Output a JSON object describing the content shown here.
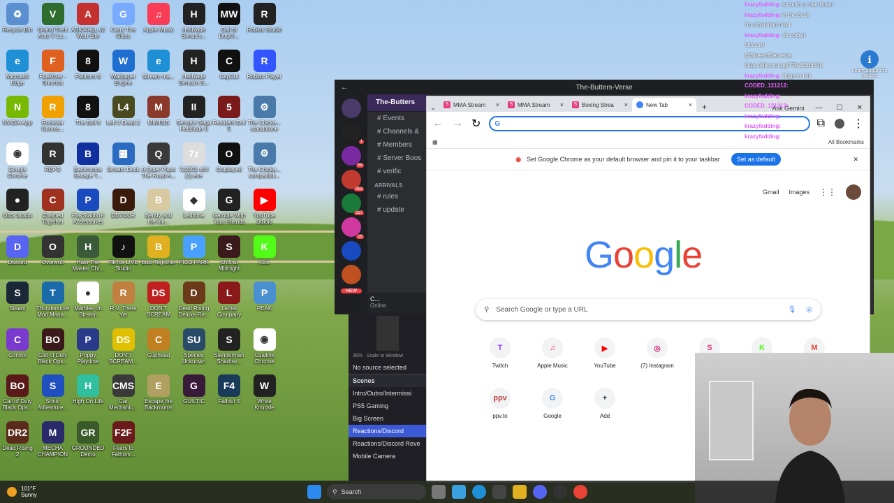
{
  "desktop": {
    "icons": [
      {
        "label": "Recycle Bin",
        "color": "#5a8fd0",
        "glyph": "♻"
      },
      {
        "label": "Grand Theft Auto V La...",
        "color": "#2e6d2e",
        "glyph": "V"
      },
      {
        "label": "ASIO4ALL v2 Web Site",
        "color": "#c43030",
        "glyph": "A"
      },
      {
        "label": "Carry The Glass",
        "color": "#78aaff",
        "glyph": "G"
      },
      {
        "label": "Apple Music",
        "color": "#fa3d56",
        "glyph": "♫"
      },
      {
        "label": "Hellblade Senua's...",
        "color": "#222",
        "glyph": "H"
      },
      {
        "label": "Call of Duty®...",
        "color": "#111",
        "glyph": "MW"
      },
      {
        "label": "Roblox Studio",
        "color": "#222",
        "glyph": "R"
      },
      {
        "label": "Microsoft Edge",
        "color": "#1f8fd6",
        "glyph": "e"
      },
      {
        "label": "FireMixer - Shortcut",
        "color": "#e06020",
        "glyph": "F"
      },
      {
        "label": "Platform 8",
        "color": "#111",
        "glyph": "8"
      },
      {
        "label": "Wallpaper Engine",
        "color": "#1e6fd0",
        "glyph": "W"
      },
      {
        "label": "Stream ma...",
        "color": "#1f8fd6",
        "glyph": "e"
      },
      {
        "label": "Hellblade Senua's S...",
        "color": "#222",
        "glyph": "H"
      },
      {
        "label": "CapCut",
        "color": "#111",
        "glyph": "C"
      },
      {
        "label": "Roblox Player",
        "color": "#3355ff",
        "glyph": "R"
      },
      {
        "label": "NVIDIA App",
        "color": "#76b900",
        "glyph": "N"
      },
      {
        "label": "Rockstar Games...",
        "color": "#f0a000",
        "glyph": "R"
      },
      {
        "label": "The Exit 8",
        "color": "#111",
        "glyph": "8"
      },
      {
        "label": "Left 4 Dead 2",
        "color": "#4a4a20",
        "glyph": "L4"
      },
      {
        "label": "MIMISIS",
        "color": "#8a3a2a",
        "glyph": "M"
      },
      {
        "label": "Senua's Saga Hellblade II",
        "color": "#222",
        "glyph": "II"
      },
      {
        "label": "Resident Evil 5",
        "color": "#7a1a1a",
        "glyph": "5"
      },
      {
        "label": "The Chicke... standalone",
        "color": "#4a7aaa",
        "glyph": "⚙"
      },
      {
        "label": "Google Chrome",
        "color": "#fff",
        "glyph": "◉"
      },
      {
        "label": "REPO",
        "color": "#333",
        "glyph": "R"
      },
      {
        "label": "Backrooms Escape T...",
        "color": "#1030a0",
        "glyph": "B"
      },
      {
        "label": "Stream Deck",
        "color": "#2a6ac0",
        "glyph": "▦"
      },
      {
        "label": "A Quiet Place The Road A...",
        "color": "#3a3a3a",
        "glyph": "Q"
      },
      {
        "label": "7z2501-x64 (1).exe",
        "color": "#ddd",
        "glyph": "7z"
      },
      {
        "label": "Outplayed",
        "color": "#111",
        "glyph": "O"
      },
      {
        "label": "The Chicke... compatibili...",
        "color": "#4a7aaa",
        "glyph": "⚙"
      },
      {
        "label": "OBS Studio",
        "color": "#222",
        "glyph": "●"
      },
      {
        "label": "Chained Together",
        "color": "#a03020",
        "glyph": "C"
      },
      {
        "label": "PlayStation® Accessories",
        "color": "#1a4ac0",
        "glyph": "P"
      },
      {
        "label": "DEVOUR",
        "color": "#3a1a0a",
        "glyph": "D"
      },
      {
        "label": "Bendy and the Ink...",
        "color": "#d8c9a0",
        "glyph": "B"
      },
      {
        "label": "Lethlime",
        "color": "#fff",
        "glyph": "◆"
      },
      {
        "label": "Gamble With Your Friends",
        "color": "#222",
        "glyph": "G"
      },
      {
        "label": "YouTube Studio",
        "color": "#ff0000",
        "glyph": "▶"
      },
      {
        "label": "Discord",
        "color": "#5865f2",
        "glyph": "D"
      },
      {
        "label": "Overwolf",
        "color": "#333",
        "glyph": "O"
      },
      {
        "label": "Halo The Master Chi...",
        "color": "#3a5a3a",
        "glyph": "H"
      },
      {
        "label": "TikTok LIVE Studio",
        "color": "#111",
        "glyph": "♪"
      },
      {
        "label": "Bust Together",
        "color": "#e0b020",
        "glyph": "B"
      },
      {
        "label": "PICO PARK",
        "color": "#4aa0ff",
        "glyph": "P"
      },
      {
        "label": "Shift at Midnight",
        "color": "#3a1a1a",
        "glyph": "S"
      },
      {
        "label": "Kick",
        "color": "#53fc18",
        "glyph": "K"
      },
      {
        "label": "Steam",
        "color": "#1b2838",
        "glyph": "S"
      },
      {
        "label": "Thunderstore Mod Mana...",
        "color": "#1a6aaa",
        "glyph": "T"
      },
      {
        "label": "Marbles on Stream",
        "color": "#fff",
        "glyph": "●"
      },
      {
        "label": "R.V. There Yet",
        "color": "#c08040",
        "glyph": "R"
      },
      {
        "label": "DON'T SCREAM",
        "color": "#c02020",
        "glyph": "DS"
      },
      {
        "label": "Dead Rising Deluxe Re...",
        "color": "#6a3a1a",
        "glyph": "D"
      },
      {
        "label": "Lethal Company",
        "color": "#8a1a1a",
        "glyph": "L"
      },
      {
        "label": "PEAK",
        "color": "#4a90d0",
        "glyph": "P"
      },
      {
        "label": "Control",
        "color": "#7a3ad0",
        "glyph": "C"
      },
      {
        "label": "Call of Duty Black Ops...",
        "color": "#3a1a1a",
        "glyph": "BO"
      },
      {
        "label": "Poppy Playtime",
        "color": "#2a3a8a",
        "glyph": "P"
      },
      {
        "label": "DON'T SCREAM...",
        "color": "#e0c000",
        "glyph": "DS"
      },
      {
        "label": "Cuphead",
        "color": "#c08020",
        "glyph": "C"
      },
      {
        "label": "Species Unknown",
        "color": "#2a4a6a",
        "glyph": "SU"
      },
      {
        "label": "Slenderman Shadow...",
        "color": "#222",
        "glyph": "S"
      },
      {
        "label": "Cuallink Chrome",
        "color": "#fff",
        "glyph": "◉"
      },
      {
        "label": "Call of Duty Black Ops...",
        "color": "#5a1a1a",
        "glyph": "BO"
      },
      {
        "label": "Sonic Adventure...",
        "color": "#2050c0",
        "glyph": "S"
      },
      {
        "label": "High On Life",
        "color": "#30c0a0",
        "glyph": "H"
      },
      {
        "label": "Car Mechanic...",
        "color": "#3a3a3a",
        "glyph": "CMS"
      },
      {
        "label": "Escape the Backrooms",
        "color": "#b0a060",
        "glyph": "E"
      },
      {
        "label": "GUILTIC",
        "color": "#3a1a3a",
        "glyph": "G"
      },
      {
        "label": "Fallout 4",
        "color": "#1a3a5a",
        "glyph": "F4"
      },
      {
        "label": "White Knuckle",
        "color": "#222",
        "glyph": "W"
      },
      {
        "label": "Dead Rising 2",
        "color": "#5a2a1a",
        "glyph": "DR2"
      },
      {
        "label": "MECHA CHAMPION",
        "color": "#2a2a6a",
        "glyph": "M"
      },
      {
        "label": "GROUNDED Demo",
        "color": "#3a5a2a",
        "glyph": "GR"
      },
      {
        "label": "Fears to Fathom...",
        "color": "#6a1a1a",
        "glyph": "F2F"
      }
    ]
  },
  "discord": {
    "title": "The-Butters-Verse",
    "server_name": "The-Butters",
    "guild_badges": [
      "1",
      "58",
      "253",
      "117",
      "16"
    ],
    "new_label": "NEW",
    "channels": [
      "Events",
      "Channels &",
      "Members",
      "Server Boos",
      "verific"
    ],
    "category": "ARRIVALS",
    "category_channels": [
      "rules",
      "update"
    ],
    "user_name": "C...",
    "user_status": "Online"
  },
  "obs": {
    "zoom": "36%",
    "scale_label": "Scale to Window",
    "no_source": "No source selected",
    "scenes_header": "Scenes",
    "scenes": [
      "Intro/Outro/Intermissi",
      "PS5 Gaming",
      "Big Screen",
      "Reactions/Discord",
      "Reactions/Discord Reve",
      "Mobile Camera"
    ],
    "selected_scene": "Reactions/Discord"
  },
  "chrome": {
    "tabs": [
      {
        "title": "MMA Stream",
        "active": false
      },
      {
        "title": "MMA Stream",
        "active": false
      },
      {
        "title": "Boxing Strea",
        "active": false
      },
      {
        "title": "New Tab",
        "active": true
      }
    ],
    "ask_gemini": "Ask Gemini",
    "omnibox_value": "",
    "all_bookmarks": "All Bookmarks",
    "infobar_text": "Set Google Chrome as your default browser and pin it to your taskbar",
    "infobar_button": "Set as default",
    "gmail": "Gmail",
    "images": "Images",
    "logo": [
      "G",
      "o",
      "o",
      "g",
      "l",
      "e"
    ],
    "logo_colors": [
      "#4285f4",
      "#ea4335",
      "#fbbc05",
      "#4285f4",
      "#34a853",
      "#ea4335"
    ],
    "search_placeholder": "Search Google or type a URL",
    "shortcuts": [
      {
        "label": "Twitch",
        "glyph": "T",
        "color": "#9146ff"
      },
      {
        "label": "Apple Music",
        "glyph": "♫",
        "color": "#fa3d56"
      },
      {
        "label": "YouTube",
        "glyph": "▶",
        "color": "#ff0000"
      },
      {
        "label": "(7) Instagram",
        "glyph": "◎",
        "color": "#d62976"
      },
      {
        "label": "Boxin",
        "glyph": "S",
        "color": "#e33e7f"
      },
      {
        "label": "",
        "glyph": "K",
        "color": "#53fc18"
      },
      {
        "label": "",
        "glyph": "M",
        "color": "#ea4335"
      },
      {
        "label": "ppv.to",
        "glyph": "ppv",
        "color": "#c04040"
      },
      {
        "label": "Google",
        "glyph": "G",
        "color": "#4285f4"
      },
      {
        "label": "Add",
        "glyph": "+",
        "color": "#333"
      }
    ]
  },
  "chat": [
    {
      "user": "krazyfadding",
      "msg": "smooth ur hair down"
    },
    {
      "user": "krazyfadding",
      "msg": "in the back"
    },
    {
      "user": "",
      "msg": "I'm download mw4"
    },
    {
      "user": "krazyfadding",
      "msg": "ok coded"
    },
    {
      "user": "",
      "msg": "!discord"
    },
    {
      "user": "",
      "msg": "@StreamElements"
    },
    {
      "user": "",
      "msg": "https://discord.gg/YRjvB3dmMp"
    },
    {
      "user": "krazyfadding",
      "msg": "lilnge in link"
    },
    {
      "user": "CODED_121212",
      "msg": ""
    },
    {
      "user": "krazyfadding",
      "msg": ""
    },
    {
      "user": "",
      "msg": ""
    },
    {
      "user": "CODED_121212",
      "msg": ""
    },
    {
      "user": "krazyfadding",
      "msg": ""
    },
    {
      "user": "krazyfadding",
      "msg": ""
    },
    {
      "user": "krazyfadding",
      "msg": ""
    }
  ],
  "taskbar": {
    "temperature": "101°F",
    "condition": "Sunny",
    "search": "Search"
  },
  "tray": {
    "learn_label": "Learn about this picture"
  }
}
